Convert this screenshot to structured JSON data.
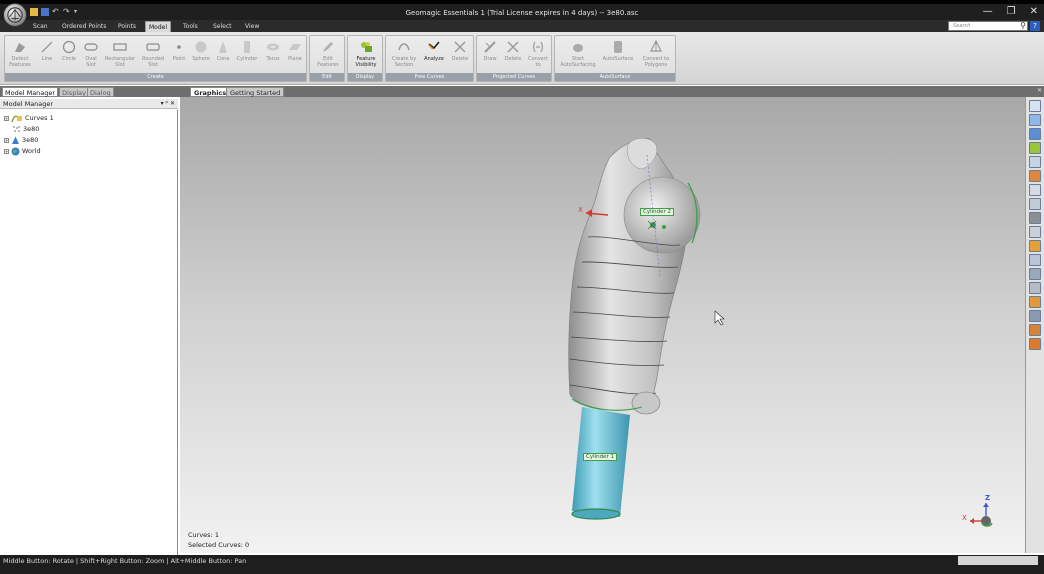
{
  "window": {
    "title": "Geomagic Essentials 1 (Trial License expires in 4 days) -- 3e80.asc",
    "minimize": "—",
    "maximize": "❐",
    "close": "✕"
  },
  "ribbon_tabs": [
    "Scan",
    "Ordered Points",
    "Points",
    "Model",
    "Tools",
    "Select",
    "View"
  ],
  "active_tab": "Model",
  "search": {
    "placeholder": "Search"
  },
  "groups": {
    "create": {
      "label": "Create",
      "buttons": [
        "Detect Features",
        "Line",
        "Circle",
        "Oval Slot",
        "Rectangular Slot",
        "Rounded Slot",
        "Point",
        "Sphere",
        "Cone",
        "Cylinder",
        "Torus",
        "Plane"
      ]
    },
    "edit": {
      "label": "Edit",
      "buttons": [
        "Edit Features"
      ]
    },
    "display": {
      "label": "Display",
      "buttons": [
        "Feature Visibility"
      ]
    },
    "free_curves": {
      "label": "Free Curves",
      "buttons": [
        "Create by Section",
        "Analyze",
        "Delete"
      ]
    },
    "projected_curves": {
      "label": "Projected Curves",
      "buttons": [
        "Draw",
        "Delete",
        "Convert to"
      ]
    },
    "autosurface": {
      "label": "AutoSurface",
      "buttons": [
        "Start AutoSurfacing",
        "AutoSurface",
        "Convert to Polygons"
      ]
    }
  },
  "left_tabs": [
    "Model Manager",
    "Display",
    "Dialog"
  ],
  "panel": {
    "title": "Model Manager",
    "controls": "▾ ᵖ ✕"
  },
  "tree": [
    {
      "label": "Curves 1",
      "icon": "curves-icon",
      "expand": "+"
    },
    {
      "label": "3e80",
      "icon": "point-cloud-icon",
      "expand": ""
    },
    {
      "label": "3e80",
      "icon": "polygon-model-icon",
      "expand": "+"
    },
    {
      "label": "World",
      "icon": "globe-icon",
      "expand": "+"
    }
  ],
  "view_tabs": [
    "Graphics",
    "Getting Started"
  ],
  "viewport": {
    "curves_count": "Curves: 1",
    "selected_curves": "Selected Curves: 0",
    "cylinder_2_label": "Cylinder 2",
    "cylinder_1_label": "Cylinder 1",
    "axis_x": "X",
    "axis_z": "Z"
  },
  "status": {
    "text": "Middle Button: Rotate | Shift+Right Button: Zoom | Alt+Middle Button: Pan"
  },
  "colors": {
    "accent": "#2a5fc1",
    "cylinder": "#5fc3dd",
    "model": "#bdbdbd"
  }
}
